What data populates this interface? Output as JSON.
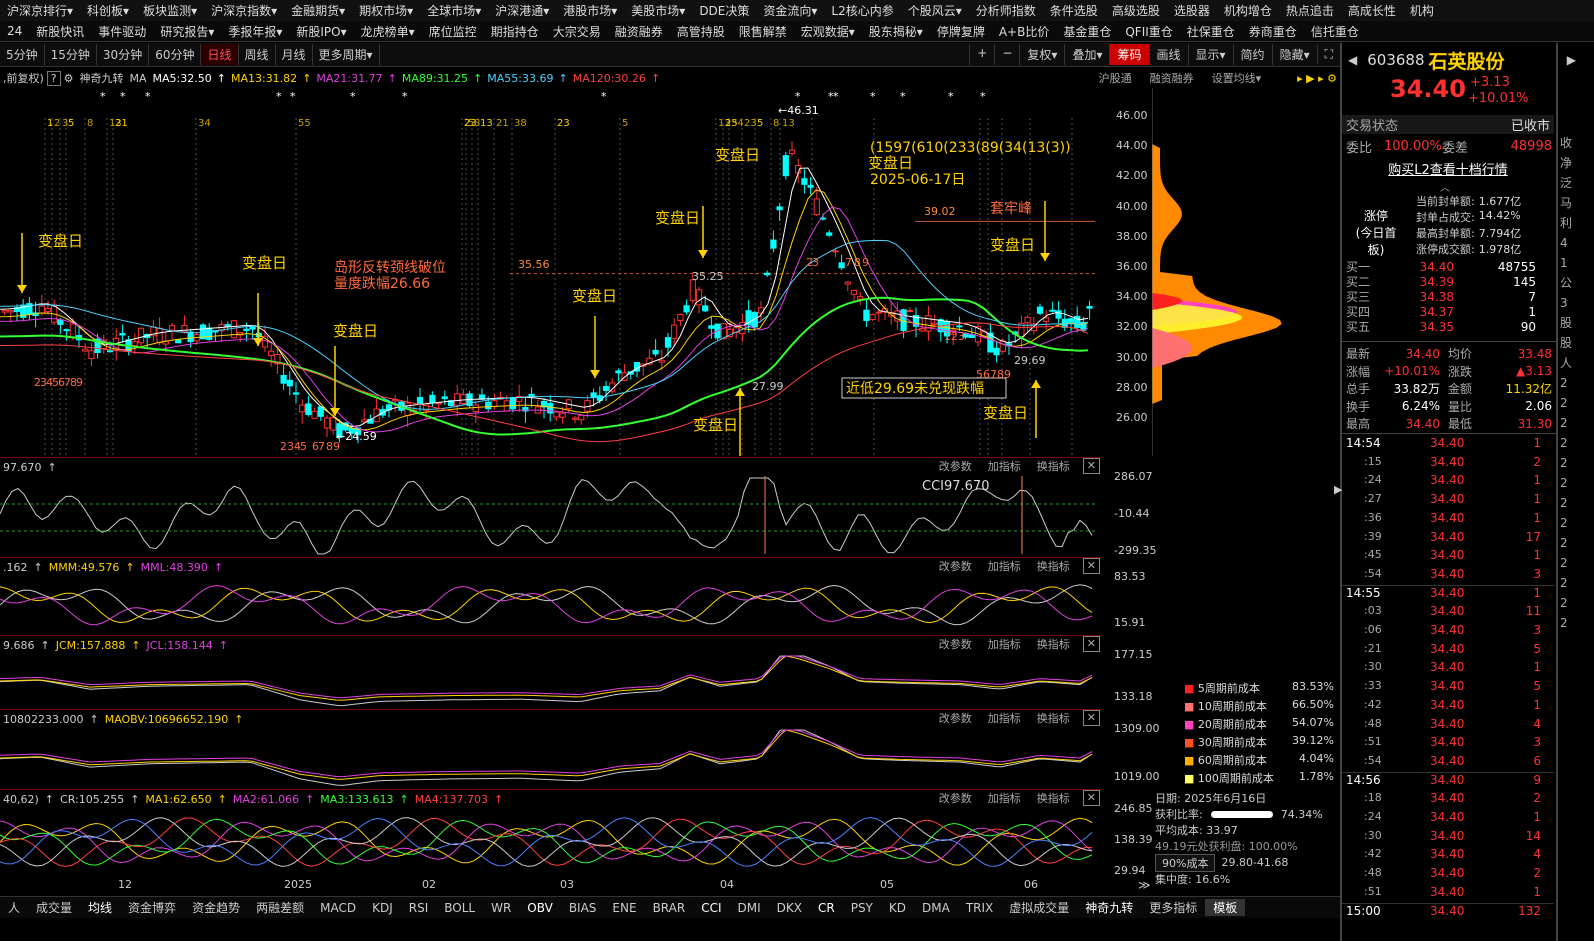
{
  "menu1": [
    "沪深京排行▾",
    "科创板▾",
    "板块监测▾",
    "沪深京指数▾",
    "金融期货▾",
    "期权市场▾",
    "全球市场▾",
    "沪深港通▾",
    "港股市场▾",
    "美股市场▾",
    "DDE决策",
    "资金流向▾",
    "L2核心内参",
    "个股风云▾",
    "分析师指数",
    "条件选股",
    "高级选股",
    "选股器",
    "机构增仓",
    "热点追击",
    "高成长性",
    "机构"
  ],
  "menu2": [
    "24",
    "新股快讯",
    "事件驱动",
    "研究报告▾",
    "季报年报▾",
    "新股IPO▾",
    "龙虎榜单▾",
    "席位监控",
    "期指持仓",
    "大宗交易",
    "融资融券",
    "高管持股",
    "限售解禁",
    "宏观数据▾",
    "股东揭秘▾",
    "停牌复牌",
    "A+B比价",
    "基金重仓",
    "QFII重仓",
    "社保重仓",
    "券商重仓",
    "信托重仓"
  ],
  "periods": [
    "5分钟",
    "15分钟",
    "30分钟",
    "60分钟",
    "日线",
    "周线",
    "月线",
    "更多周期▾"
  ],
  "active_period": "日线",
  "toolbar_right": [
    "+",
    "−",
    "复权▾",
    "叠加▾",
    "筹码",
    "画线",
    "显示▾",
    "简约",
    "隐藏▾"
  ],
  "ma_bar": {
    "prefix": ",前复权)",
    "help": "?",
    "name": "神奇九转",
    "ma": "MA",
    "items": [
      {
        "label": "MA5:32.50",
        "color": "#ffffff"
      },
      {
        "label": "MA13:31.82",
        "color": "#ffd200"
      },
      {
        "label": "MA21:31.77",
        "color": "#e040e0"
      },
      {
        "label": "MA89:31.25",
        "color": "#33ff33"
      },
      {
        "label": "MA55:33.69",
        "color": "#4ad2ff"
      },
      {
        "label": "MA120:30.26",
        "color": "#ff4040"
      }
    ],
    "links": [
      "沪股通",
      "融资融券",
      "设置均线▾"
    ]
  },
  "price_axis": [
    "46.00",
    "44.00",
    "42.00",
    "40.00",
    "38.00",
    "36.00",
    "34.00",
    "32.00",
    "30.00",
    "28.00",
    "26.00"
  ],
  "main_annotations": {
    "change_day": "变盘日",
    "island": "岛形反转颈线破位",
    "drop": "量度跌幅26.66",
    "high_label": "←46.31",
    "low_label": "←24.59",
    "l3599": "35.56",
    "l3525": "35.25",
    "l2799": "27.99",
    "l3902": "39.02",
    "tao_lao": "套牢峰",
    "near_low": "近低29.69未兑现跌幅",
    "l2969": "29.69",
    "seq": "(1597(610(233(89(34(13(3))",
    "date_label": "2025-06-17日",
    "nums_top": [
      "1",
      "2",
      "3",
      "5",
      "8",
      "13",
      "21",
      "34",
      "55",
      "23",
      "5",
      "8",
      "13",
      "21",
      "38",
      "23",
      "5",
      "13",
      "25",
      "34",
      "23",
      "5",
      "8",
      "13"
    ],
    "nums_bottom": [
      "2",
      "3",
      "4",
      "5",
      "6",
      "7",
      "8",
      "9",
      "2",
      "3",
      "4",
      "5",
      "6",
      "7",
      "8",
      "9",
      "2",
      "3",
      "7",
      "8",
      "9",
      "5",
      "6",
      "7",
      "8",
      "9",
      "1",
      "2",
      "3"
    ]
  },
  "panels": [
    {
      "items": [
        {
          "label": "97.670",
          "color": "#ccc"
        }
      ],
      "axis": [
        "286.07",
        "-10.44",
        "-299.35"
      ],
      "annot": "CCI97.670"
    },
    {
      "items": [
        {
          "label": ".162",
          "color": "#ccc"
        },
        {
          "label": "MMM:49.576",
          "color": "#ffd200"
        },
        {
          "label": "MML:48.390",
          "color": "#e040e0"
        }
      ],
      "axis": [
        "83.53",
        "15.91"
      ]
    },
    {
      "items": [
        {
          "label": "9.686",
          "color": "#ccc"
        },
        {
          "label": "JCM:157.888",
          "color": "#ffd200"
        },
        {
          "label": "JCL:158.144",
          "color": "#e040e0"
        }
      ],
      "axis": [
        "177.15",
        "133.18"
      ]
    },
    {
      "items": [
        {
          "label": "10802233.000",
          "color": "#ccc"
        },
        {
          "label": "MAOBV:10696652.190",
          "color": "#ffd200"
        }
      ],
      "axis": [
        "1309.00",
        "1019.00"
      ]
    },
    {
      "items": [
        {
          "label": "40,62)",
          "color": "#ccc"
        },
        {
          "label": "CR:105.255",
          "color": "#ccc"
        },
        {
          "label": "MA1:62.650",
          "color": "#ffd200"
        },
        {
          "label": "MA2:61.066",
          "color": "#e040e0"
        },
        {
          "label": "MA3:133.613",
          "color": "#33ff33"
        },
        {
          "label": "MA4:137.703",
          "color": "#ff4040"
        }
      ],
      "axis": [
        "246.85",
        "138.39",
        "29.94"
      ]
    }
  ],
  "panel_ops": [
    "改参数",
    "加指标",
    "换指标"
  ],
  "x_axis": [
    "12",
    "2025",
    "02",
    "03",
    "04",
    "05",
    "06"
  ],
  "bottom_tabs": [
    "人",
    "成交量",
    "均线",
    "资金博弈",
    "资金趋势",
    "两融差额",
    "MACD",
    "KDJ",
    "RSI",
    "BOLL",
    "WR",
    "OBV",
    "BIAS",
    "ENE",
    "BRAR",
    "CCI",
    "DMI",
    "DKX",
    "CR",
    "PSY",
    "KD",
    "DMA",
    "TRIX",
    "虚拟成交量",
    "神奇九转",
    "更多指标",
    "模板"
  ],
  "cost_legend": [
    {
      "label": "5周期前成本",
      "value": "83.53%",
      "color": "#ff2020"
    },
    {
      "label": "10周期前成本",
      "value": "66.50%",
      "color": "#ff7070"
    },
    {
      "label": "20周期前成本",
      "value": "54.07%",
      "color": "#ff40c0"
    },
    {
      "label": "30周期前成本",
      "value": "39.12%",
      "color": "#ff5020"
    },
    {
      "label": "60周期前成本",
      "value": "4.04%",
      "color": "#ffb000"
    },
    {
      "label": "100周期前成本",
      "value": "1.78%",
      "color": "#ffff60"
    }
  ],
  "chip_info": {
    "date": "日期: 2025年6月16日",
    "profit_label": "获利比率:",
    "profit": "74.34%",
    "avg": "平均成本: 33.97",
    "note": "49.19元处获利盘: 100.00%",
    "select": "90%成本",
    "range": "29.80-41.68",
    "conc": "集中度: 16.6%"
  },
  "quote": {
    "code": "603688",
    "name": "石英股份",
    "price": "34.40",
    "chg": "+3.13",
    "pct": "+10.01%",
    "status_label": "交易状态",
    "status": "已收市",
    "wb_label": "委比",
    "wb": "100.00%",
    "wc_label": "委差",
    "wc": "48998",
    "l2_link": "购买L2查看十档行情",
    "limit_title": "涨停",
    "limit_sub": "(今日首板)",
    "limit_rows": [
      {
        "k": "当前封单额:",
        "v": "1.677亿"
      },
      {
        "k": "封单占成交:",
        "v": "14.42%"
      },
      {
        "k": "最高封单额:",
        "v": "7.794亿"
      },
      {
        "k": "涨停成交额:",
        "v": "1.978亿"
      }
    ],
    "bids": [
      {
        "k": "买一",
        "p": "34.40",
        "v": "48755"
      },
      {
        "k": "买二",
        "p": "34.39",
        "v": "145"
      },
      {
        "k": "买三",
        "p": "34.38",
        "v": "7"
      },
      {
        "k": "买四",
        "p": "34.37",
        "v": "1"
      },
      {
        "k": "买五",
        "p": "34.35",
        "v": "90"
      }
    ],
    "stats": [
      {
        "k1": "最新",
        "v1": "34.40",
        "k2": "均价",
        "v2": "33.48"
      },
      {
        "k1": "涨幅",
        "v1": "+10.01%",
        "k2": "涨跌",
        "v2": "▲3.13"
      },
      {
        "k1": "总手",
        "v1": "33.82万",
        "k2": "金额",
        "v2": "11.32亿"
      },
      {
        "k1": "换手",
        "v1": "6.24%",
        "k2": "量比",
        "v2": "2.06"
      },
      {
        "k1": "最高",
        "v1": "34.40",
        "k2": "最低",
        "v2": "31.30"
      }
    ],
    "ticks": [
      {
        "t": "14:54",
        "p": "34.40",
        "v": "1"
      },
      {
        "t": ":15",
        "p": "34.40",
        "v": "2"
      },
      {
        "t": ":24",
        "p": "34.40",
        "v": "1"
      },
      {
        "t": ":27",
        "p": "34.40",
        "v": "1"
      },
      {
        "t": ":36",
        "p": "34.40",
        "v": "1"
      },
      {
        "t": ":39",
        "p": "34.40",
        "v": "17"
      },
      {
        "t": ":45",
        "p": "34.40",
        "v": "1"
      },
      {
        "t": ":54",
        "p": "34.40",
        "v": "3"
      },
      {
        "t": "14:55",
        "p": "34.40",
        "v": "1"
      },
      {
        "t": ":03",
        "p": "34.40",
        "v": "11"
      },
      {
        "t": ":06",
        "p": "34.40",
        "v": "3"
      },
      {
        "t": ":21",
        "p": "34.40",
        "v": "5"
      },
      {
        "t": ":30",
        "p": "34.40",
        "v": "1"
      },
      {
        "t": ":33",
        "p": "34.40",
        "v": "5"
      },
      {
        "t": ":42",
        "p": "34.40",
        "v": "1"
      },
      {
        "t": ":48",
        "p": "34.40",
        "v": "4"
      },
      {
        "t": ":51",
        "p": "34.40",
        "v": "3"
      },
      {
        "t": ":54",
        "p": "34.40",
        "v": "6"
      },
      {
        "t": "14:56",
        "p": "34.40",
        "v": "9"
      },
      {
        "t": ":18",
        "p": "34.40",
        "v": "2"
      },
      {
        "t": ":24",
        "p": "34.40",
        "v": "1"
      },
      {
        "t": ":30",
        "p": "34.40",
        "v": "14"
      },
      {
        "t": ":42",
        "p": "34.40",
        "v": "4"
      },
      {
        "t": ":48",
        "p": "34.40",
        "v": "2"
      },
      {
        "t": ":51",
        "p": "34.40",
        "v": "1"
      },
      {
        "t": "15:00",
        "p": "34.40",
        "v": "132"
      }
    ],
    "edge_chars": [
      "收",
      "净",
      "泛",
      "马",
      "利",
      "4",
      "1",
      "公",
      "3",
      "股",
      "股",
      "人",
      "2",
      "2",
      "2",
      "2",
      "2",
      "2",
      "2",
      "2",
      "2",
      "2",
      "2",
      "2",
      "2"
    ]
  }
}
